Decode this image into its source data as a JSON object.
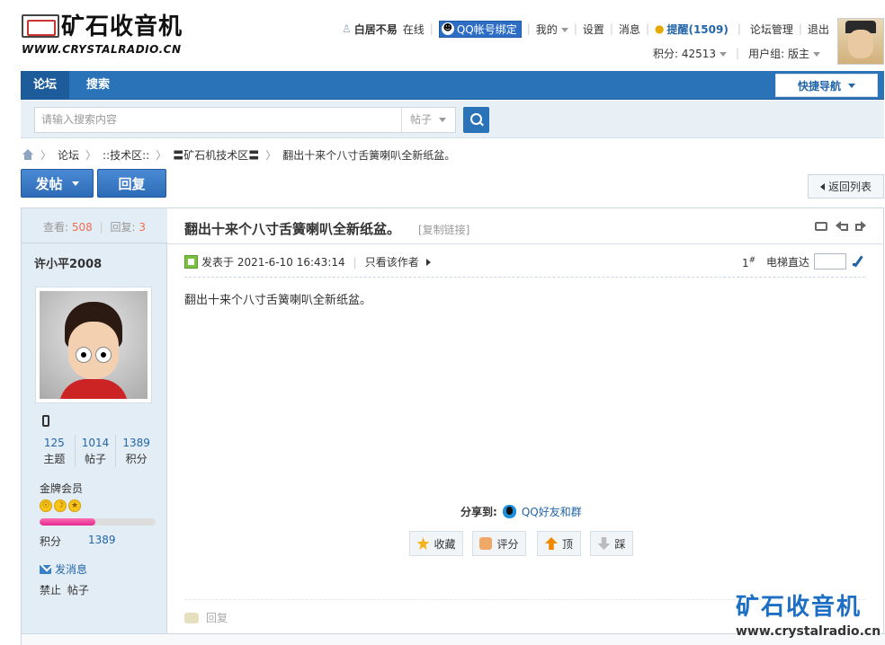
{
  "header": {
    "logo_text": "矿石收音机",
    "logo_url": "WWW.CRYSTALRADIO.CN",
    "username": "白居不易",
    "online_status": "在线",
    "qq_bind": "QQ帐号绑定",
    "my": "我的",
    "settings": "设置",
    "messages": "消息",
    "remind": "提醒(1509)",
    "forum_manage": "论坛管理",
    "logout": "退出",
    "points": "积分: 42513",
    "usergroup": "用户组: 版主"
  },
  "nav": {
    "items": [
      {
        "label": "论坛"
      },
      {
        "label": "搜索"
      }
    ],
    "quick_nav": "快捷导航"
  },
  "search": {
    "placeholder": "请输入搜索内容",
    "type": "帖子"
  },
  "breadcrumb": [
    "论坛",
    "::技术区::",
    "〓矿石机技术区〓",
    "翻出十来个八寸舌簧喇叭全新纸盆。"
  ],
  "buttons": {
    "post": "发帖",
    "reply": "回复",
    "back": "返回列表"
  },
  "thread": {
    "views_label": "查看:",
    "views": "508",
    "replies_label": "回复:",
    "replies": "3",
    "title": "翻出十来个八寸舌簧喇叭全新纸盆。",
    "copy_link": "[复制链接]"
  },
  "author": {
    "name": "许小平2008",
    "stats": [
      {
        "value": "125",
        "label": "主题"
      },
      {
        "value": "1014",
        "label": "帖子"
      },
      {
        "value": "1389",
        "label": "积分"
      }
    ],
    "group": "金牌会员",
    "progress": 0.48,
    "points_label": "积分",
    "points_value": "1389",
    "send_msg": "发消息",
    "ban": "禁止 帖子"
  },
  "post": {
    "posted_at": "发表于 2021-6-10 16:43:14",
    "only_author": "只看该作者",
    "floor": "1",
    "floor_sup": "#",
    "jump_label": "电梯直达",
    "content": "翻出十来个八寸舌簧喇叭全新纸盆。",
    "share_label": "分享到:",
    "share_qq": "QQ好友和群",
    "actions": {
      "fav": "收藏",
      "rate": "评分",
      "top": "顶",
      "down": "踩"
    },
    "reply_quick": "回复"
  },
  "watermark": {
    "title": "矿石收音机",
    "url": "www.crystalradio.cn"
  },
  "colors": {
    "accent": "#2b73b8",
    "link": "#2366a8",
    "highlight": "#f26c4f"
  }
}
